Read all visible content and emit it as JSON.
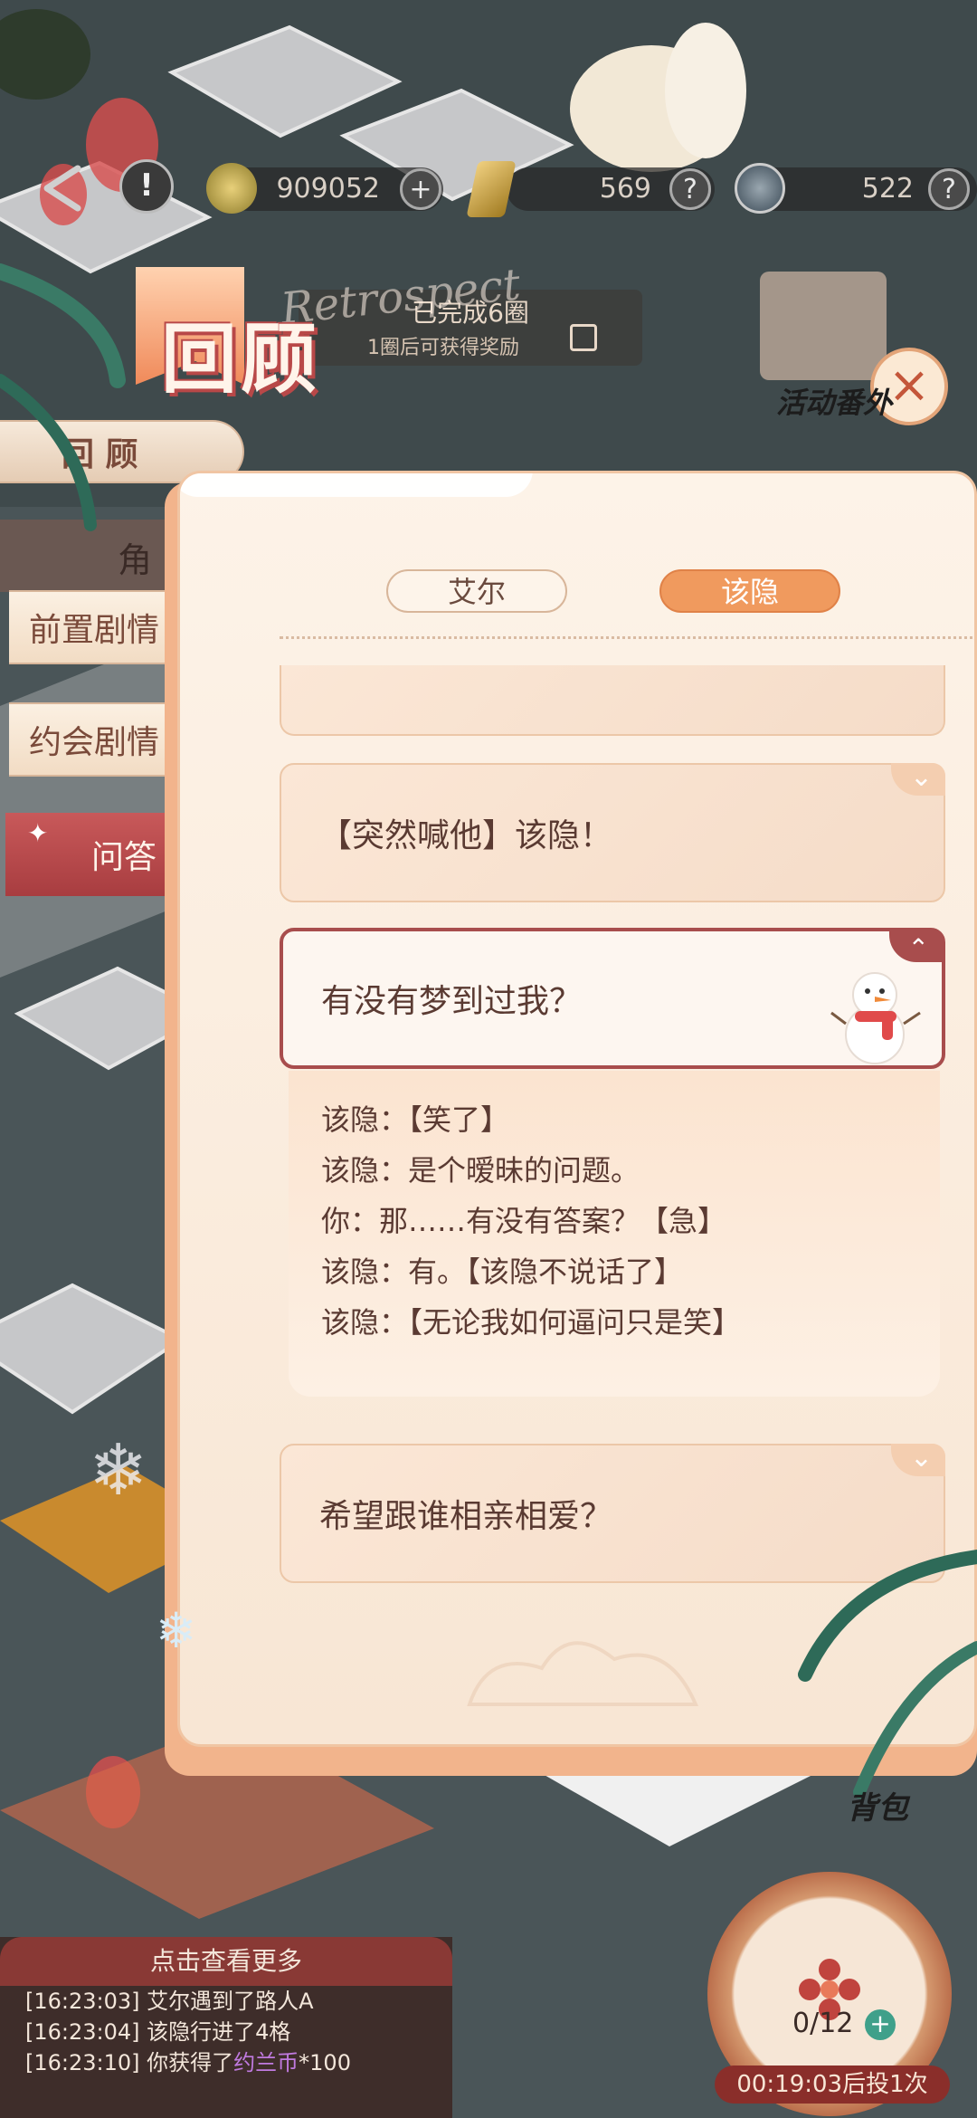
{
  "resources": {
    "coins": "909052",
    "gems": "569",
    "energy": "522",
    "add_symbol": "+",
    "help_symbol": "?"
  },
  "header": {
    "title": "回顾",
    "script_word": "Retrospect",
    "progress_text": "已完成6圈",
    "reward_hint": "1圈后可获得奖励"
  },
  "side_menu": {
    "review_label": "回 顾",
    "role_label": "角",
    "items": [
      "前置剧情",
      "约会剧情",
      "问答"
    ]
  },
  "right_labels": {
    "activity": "活动番外",
    "bag": "背包"
  },
  "character_tabs": [
    "艾尔",
    "该隐"
  ],
  "active_tab_index": 1,
  "qa": {
    "question1": "【突然喊他】该隐！",
    "question2": "有没有梦到过我？",
    "answer_lines": [
      "该隐：【笑了】",
      "该隐：是个暧昧的问题。",
      "你：那……有没有答案？【急】",
      "该隐：有。【该隐不说话了】",
      "该隐：【无论我如何逼问只是笑】"
    ],
    "question3": "希望跟谁相亲相爱？",
    "chevron_down": "⌄",
    "chevron_up": "⌃"
  },
  "log": {
    "header": "点击查看更多",
    "entries": [
      {
        "time": "[16:23:03]",
        "text": "艾尔遇到了路人A",
        "highlight": ""
      },
      {
        "time": "[16:23:04]",
        "text": "该隐行进了4格",
        "highlight": ""
      },
      {
        "time": "[16:23:10]",
        "text": "你获得了",
        "highlight": "约兰币",
        "suffix": "*100"
      }
    ]
  },
  "dice": {
    "count": "0/12",
    "timer": "00:19:03后投1次"
  },
  "close_symbol": "×",
  "colors": {
    "accent_orange": "#f09a5e",
    "accent_red": "#a84d4d",
    "panel_bg": "#fdf3e8"
  }
}
